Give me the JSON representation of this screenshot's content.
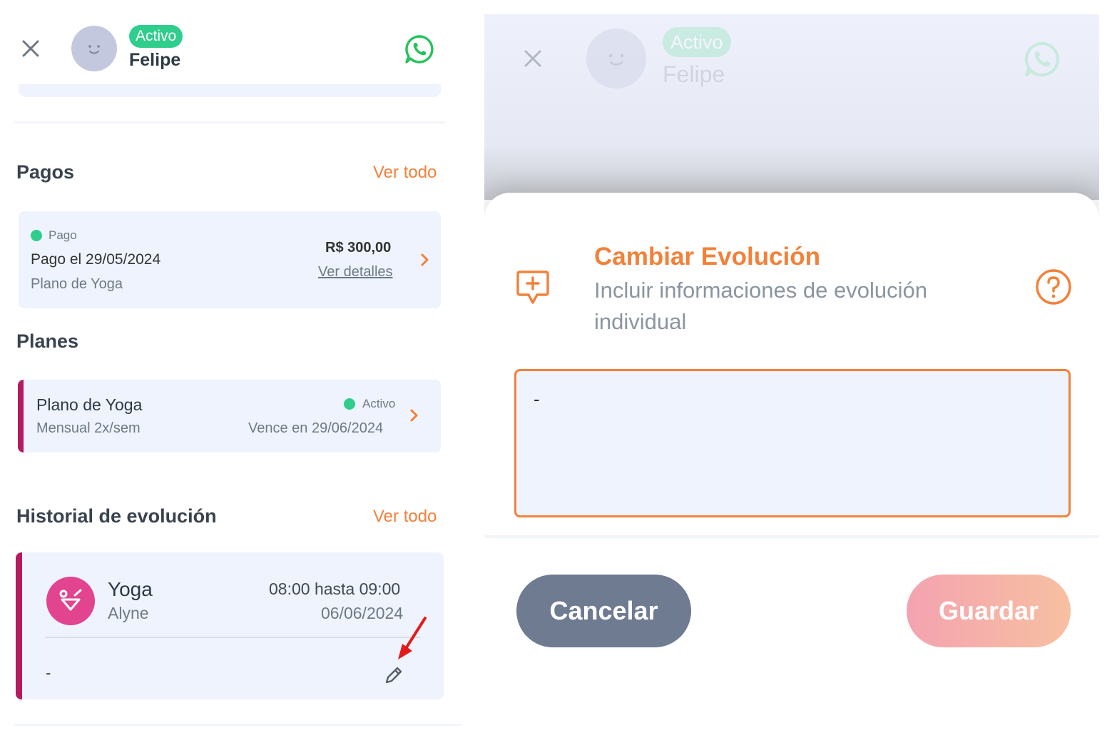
{
  "header": {
    "status_badge": "Activo",
    "user_name": "Felipe"
  },
  "payments": {
    "title": "Pagos",
    "see_all": "Ver todo",
    "card": {
      "status": "Pago",
      "paid_on": "Pago el 29/05/2024",
      "plan": "Plano de Yoga",
      "amount": "R$ 300,00",
      "details_link": "Ver detalles"
    }
  },
  "plans": {
    "title": "Planes",
    "card": {
      "name": "Plano de Yoga",
      "frequency": "Mensual 2x/sem",
      "status": "Activo",
      "expires": "Vence en 29/06/2024"
    }
  },
  "evolution_history": {
    "title": "Historial de evolución",
    "see_all": "Ver todo",
    "card": {
      "class_name": "Yoga",
      "instructor": "Alyne",
      "time_range": "08:00 hasta 09:00",
      "date": "06/06/2024",
      "note": "-"
    }
  },
  "modal": {
    "title": "Cambiar Evolución",
    "subtitle": "Incluir informaciones de evolución individual",
    "textarea_value": "-",
    "cancel_label": "Cancelar",
    "save_label": "Guardar"
  },
  "colors": {
    "accent": "#f2813a",
    "active_green": "#2fce8c",
    "card_bg": "#eef3fd",
    "plan_stripe": "#b5195f",
    "yoga_icon_bg": "#e2448f",
    "cancel_button": "#6e7b91"
  }
}
